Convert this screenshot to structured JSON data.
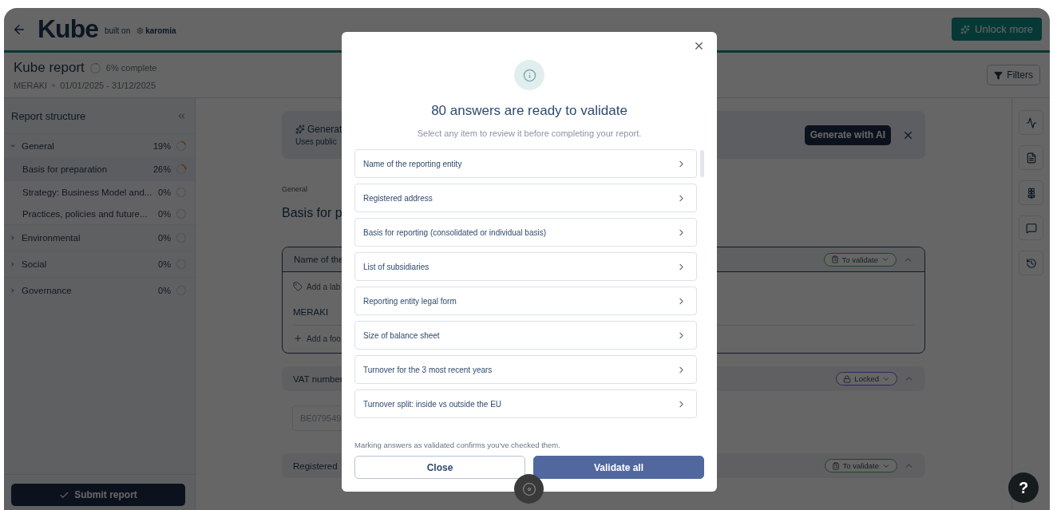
{
  "header": {
    "logo": "Kube",
    "built_on": "built on",
    "partner": "karomia",
    "unlock_button": "Unlock more"
  },
  "report": {
    "title": "Kube report",
    "progress": {
      "label": "6% complete"
    },
    "company": "MERAKI",
    "period": "01/01/2025 - 31/12/2025",
    "filters_button": "Filters"
  },
  "sidebar": {
    "title": "Report structure",
    "items": [
      {
        "label": "General",
        "percent": "19%",
        "expanded": true,
        "children": [
          {
            "label": "Basis for preparation",
            "percent": "26%",
            "selected": true
          },
          {
            "label": "Strategy: Business Model and...",
            "percent": "0%",
            "selected": false
          },
          {
            "label": "Practices, policies and future...",
            "percent": "0%",
            "selected": false
          }
        ]
      },
      {
        "label": "Environmental",
        "percent": "0%",
        "expanded": false
      },
      {
        "label": "Social",
        "percent": "0%",
        "expanded": false
      },
      {
        "label": "Governance",
        "percent": "0%",
        "expanded": false
      }
    ],
    "submit_button": "Submit report"
  },
  "banner": {
    "title": "Generat",
    "subtitle": "Uses public",
    "button": "Generate with AI"
  },
  "content": {
    "breadcrumb": "General",
    "heading": "Basis for p",
    "questions": [
      {
        "title": "Name of the",
        "status": {
          "kind": "to_validate",
          "label": "To validate"
        },
        "expanded": true,
        "label_placeholder": "Add a lab",
        "value": "MERAKI",
        "footnote_placeholder": "Add a foo"
      },
      {
        "title": "VAT number",
        "status": {
          "kind": "locked",
          "label": "Locked"
        },
        "expanded": false,
        "value": "BE079549"
      },
      {
        "title": "Registered",
        "status": {
          "kind": "to_validate",
          "label": "To validate"
        },
        "expanded": false
      }
    ]
  },
  "dialog": {
    "title": "80 answers are ready to validate",
    "subtitle": "Select any item to review it before completing your report.",
    "items": [
      "Name of the reporting entity",
      "Registered address",
      "Basis for reporting (consolidated or individual basis)",
      "List of subsidiaries",
      "Reporting entity legal form",
      "Size of balance sheet",
      "Turnover for the 3 most recent years",
      "Turnover split: inside vs outside the EU"
    ],
    "note": "Marking answers as validated confirms you've checked them.",
    "buttons": [
      "Close",
      "Validate all"
    ]
  },
  "help_button": "?"
}
